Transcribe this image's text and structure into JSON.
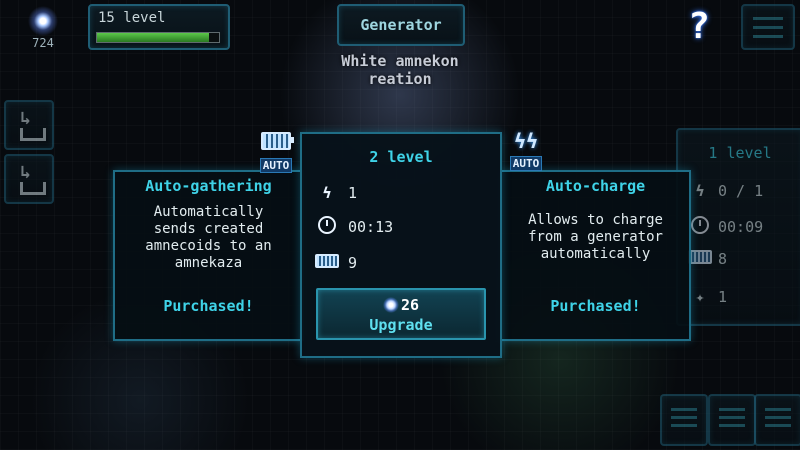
{
  "resource": {
    "icon": "energy-spark-icon",
    "value": "724"
  },
  "level_box": {
    "label": "15 level",
    "progress_fraction": 0.92
  },
  "generator": {
    "button_label": "Generator",
    "subtitle_line1": "White amnekon",
    "subtitle_line2": "reation"
  },
  "help": {
    "label": "?"
  },
  "upgrade_panel": {
    "level": "2 level",
    "rows": [
      {
        "icon": "lightning-icon",
        "value": "1"
      },
      {
        "icon": "clock-icon",
        "value": "00:13"
      },
      {
        "icon": "battery-icon",
        "value": "9"
      }
    ],
    "upgrade_cost": "26",
    "upgrade_label": "Upgrade"
  },
  "auto_gathering": {
    "badge": "AUTO",
    "title": "Auto-gathering",
    "desc_lines": [
      "Automatically",
      "sends created",
      "amnecoids to an",
      "amnekaza"
    ],
    "status": "Purchased!"
  },
  "auto_charge": {
    "badge": "AUTO",
    "title": "Auto-charge",
    "desc_lines": [
      "Allows to charge",
      "from a generator",
      "automatically"
    ],
    "status": "Purchased!"
  },
  "right_panel": {
    "level": "1 level",
    "rows": [
      {
        "icon": "lightning-icon",
        "value": "0 / 1"
      },
      {
        "icon": "clock-icon",
        "value": "00:09"
      },
      {
        "icon": "battery-icon",
        "value": "8"
      },
      {
        "icon": "spark-icon",
        "value": "1"
      }
    ]
  },
  "colors": {
    "accent": "#3fd3e8",
    "border": "#1f6d86",
    "progress": "#5cc84a"
  }
}
